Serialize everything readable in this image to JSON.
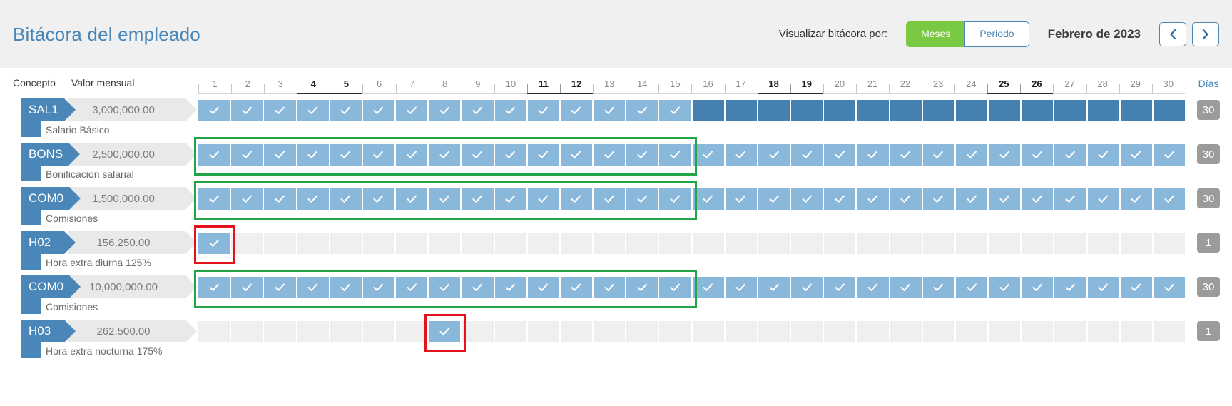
{
  "header": {
    "title": "Bitácora del empleado",
    "visualize_label": "Visualizar bitácora por:",
    "toggle": {
      "meses": "Meses",
      "periodo": "Periodo",
      "active": "Meses"
    },
    "period": "Febrero de 2023",
    "prev_icon": "chevron-left-icon",
    "next_icon": "chevron-right-icon"
  },
  "table": {
    "col_concepto": "Concepto",
    "col_valor": "Valor mensual",
    "col_dias": "Días",
    "days": [
      1,
      2,
      3,
      4,
      5,
      6,
      7,
      8,
      9,
      10,
      11,
      12,
      13,
      14,
      15,
      16,
      17,
      18,
      19,
      20,
      21,
      22,
      23,
      24,
      25,
      26,
      27,
      28,
      29,
      30
    ],
    "weekend_days": [
      4,
      5,
      11,
      12,
      18,
      19,
      25,
      26
    ],
    "rows": [
      {
        "code": "SAL1",
        "value": "3,000,000.00",
        "description": "Salario Básico",
        "dias": "30",
        "checked_days": [
          1,
          2,
          3,
          4,
          5,
          6,
          7,
          8,
          9,
          10,
          11,
          12,
          13,
          14,
          15
        ],
        "selected_days": [
          16,
          17,
          18,
          19,
          20,
          21,
          22,
          23,
          24,
          25,
          26,
          27,
          28,
          29,
          30
        ]
      },
      {
        "code": "BONS",
        "value": "2,500,000.00",
        "description": "Bonificación salarial",
        "dias": "30",
        "checked_days": [
          1,
          2,
          3,
          4,
          5,
          6,
          7,
          8,
          9,
          10,
          11,
          12,
          13,
          14,
          15,
          16,
          17,
          18,
          19,
          20,
          21,
          22,
          23,
          24,
          25,
          26,
          27,
          28,
          29,
          30
        ],
        "selected_days": []
      },
      {
        "code": "COM0",
        "value": "1,500,000.00",
        "description": "Comisiones",
        "dias": "30",
        "checked_days": [
          1,
          2,
          3,
          4,
          5,
          6,
          7,
          8,
          9,
          10,
          11,
          12,
          13,
          14,
          15,
          16,
          17,
          18,
          19,
          20,
          21,
          22,
          23,
          24,
          25,
          26,
          27,
          28,
          29,
          30
        ],
        "selected_days": []
      },
      {
        "code": "H02",
        "value": "156,250.00",
        "description": "Hora extra diurna 125%",
        "dias": "1",
        "checked_days": [
          1
        ],
        "selected_days": []
      },
      {
        "code": "COM0",
        "value": "10,000,000.00",
        "description": "Comisiones",
        "dias": "30",
        "checked_days": [
          1,
          2,
          3,
          4,
          5,
          6,
          7,
          8,
          9,
          10,
          11,
          12,
          13,
          14,
          15,
          16,
          17,
          18,
          19,
          20,
          21,
          22,
          23,
          24,
          25,
          26,
          27,
          28,
          29,
          30
        ],
        "selected_days": []
      },
      {
        "code": "H03",
        "value": "262,500.00",
        "description": "Hora extra nocturna 175%",
        "dias": "1",
        "checked_days": [
          8
        ],
        "selected_days": []
      }
    ]
  },
  "annotations": [
    {
      "name": "green-box-bons",
      "color": "#22a546",
      "row": 1,
      "from_day": 1,
      "to_day": 15
    },
    {
      "name": "green-box-com0",
      "color": "#22a546",
      "row": 2,
      "from_day": 1,
      "to_day": 15
    },
    {
      "name": "red-box-h02",
      "color": "#e4121a",
      "row": 3,
      "from_day": 1,
      "to_day": 1
    },
    {
      "name": "green-box-com0b",
      "color": "#22a546",
      "row": 4,
      "from_day": 1,
      "to_day": 15
    },
    {
      "name": "red-box-h03",
      "color": "#e4121a",
      "row": 5,
      "from_day": 8,
      "to_day": 8
    }
  ],
  "colors": {
    "title": "#4a87b8",
    "accent_green": "#7ac943",
    "cell_on": "#8ab8db",
    "cell_selected": "#4580b0",
    "cell_off": "#efefef",
    "badge_gray": "#9b9b9b",
    "annotation_green": "#22a546",
    "annotation_red": "#e4121a"
  }
}
